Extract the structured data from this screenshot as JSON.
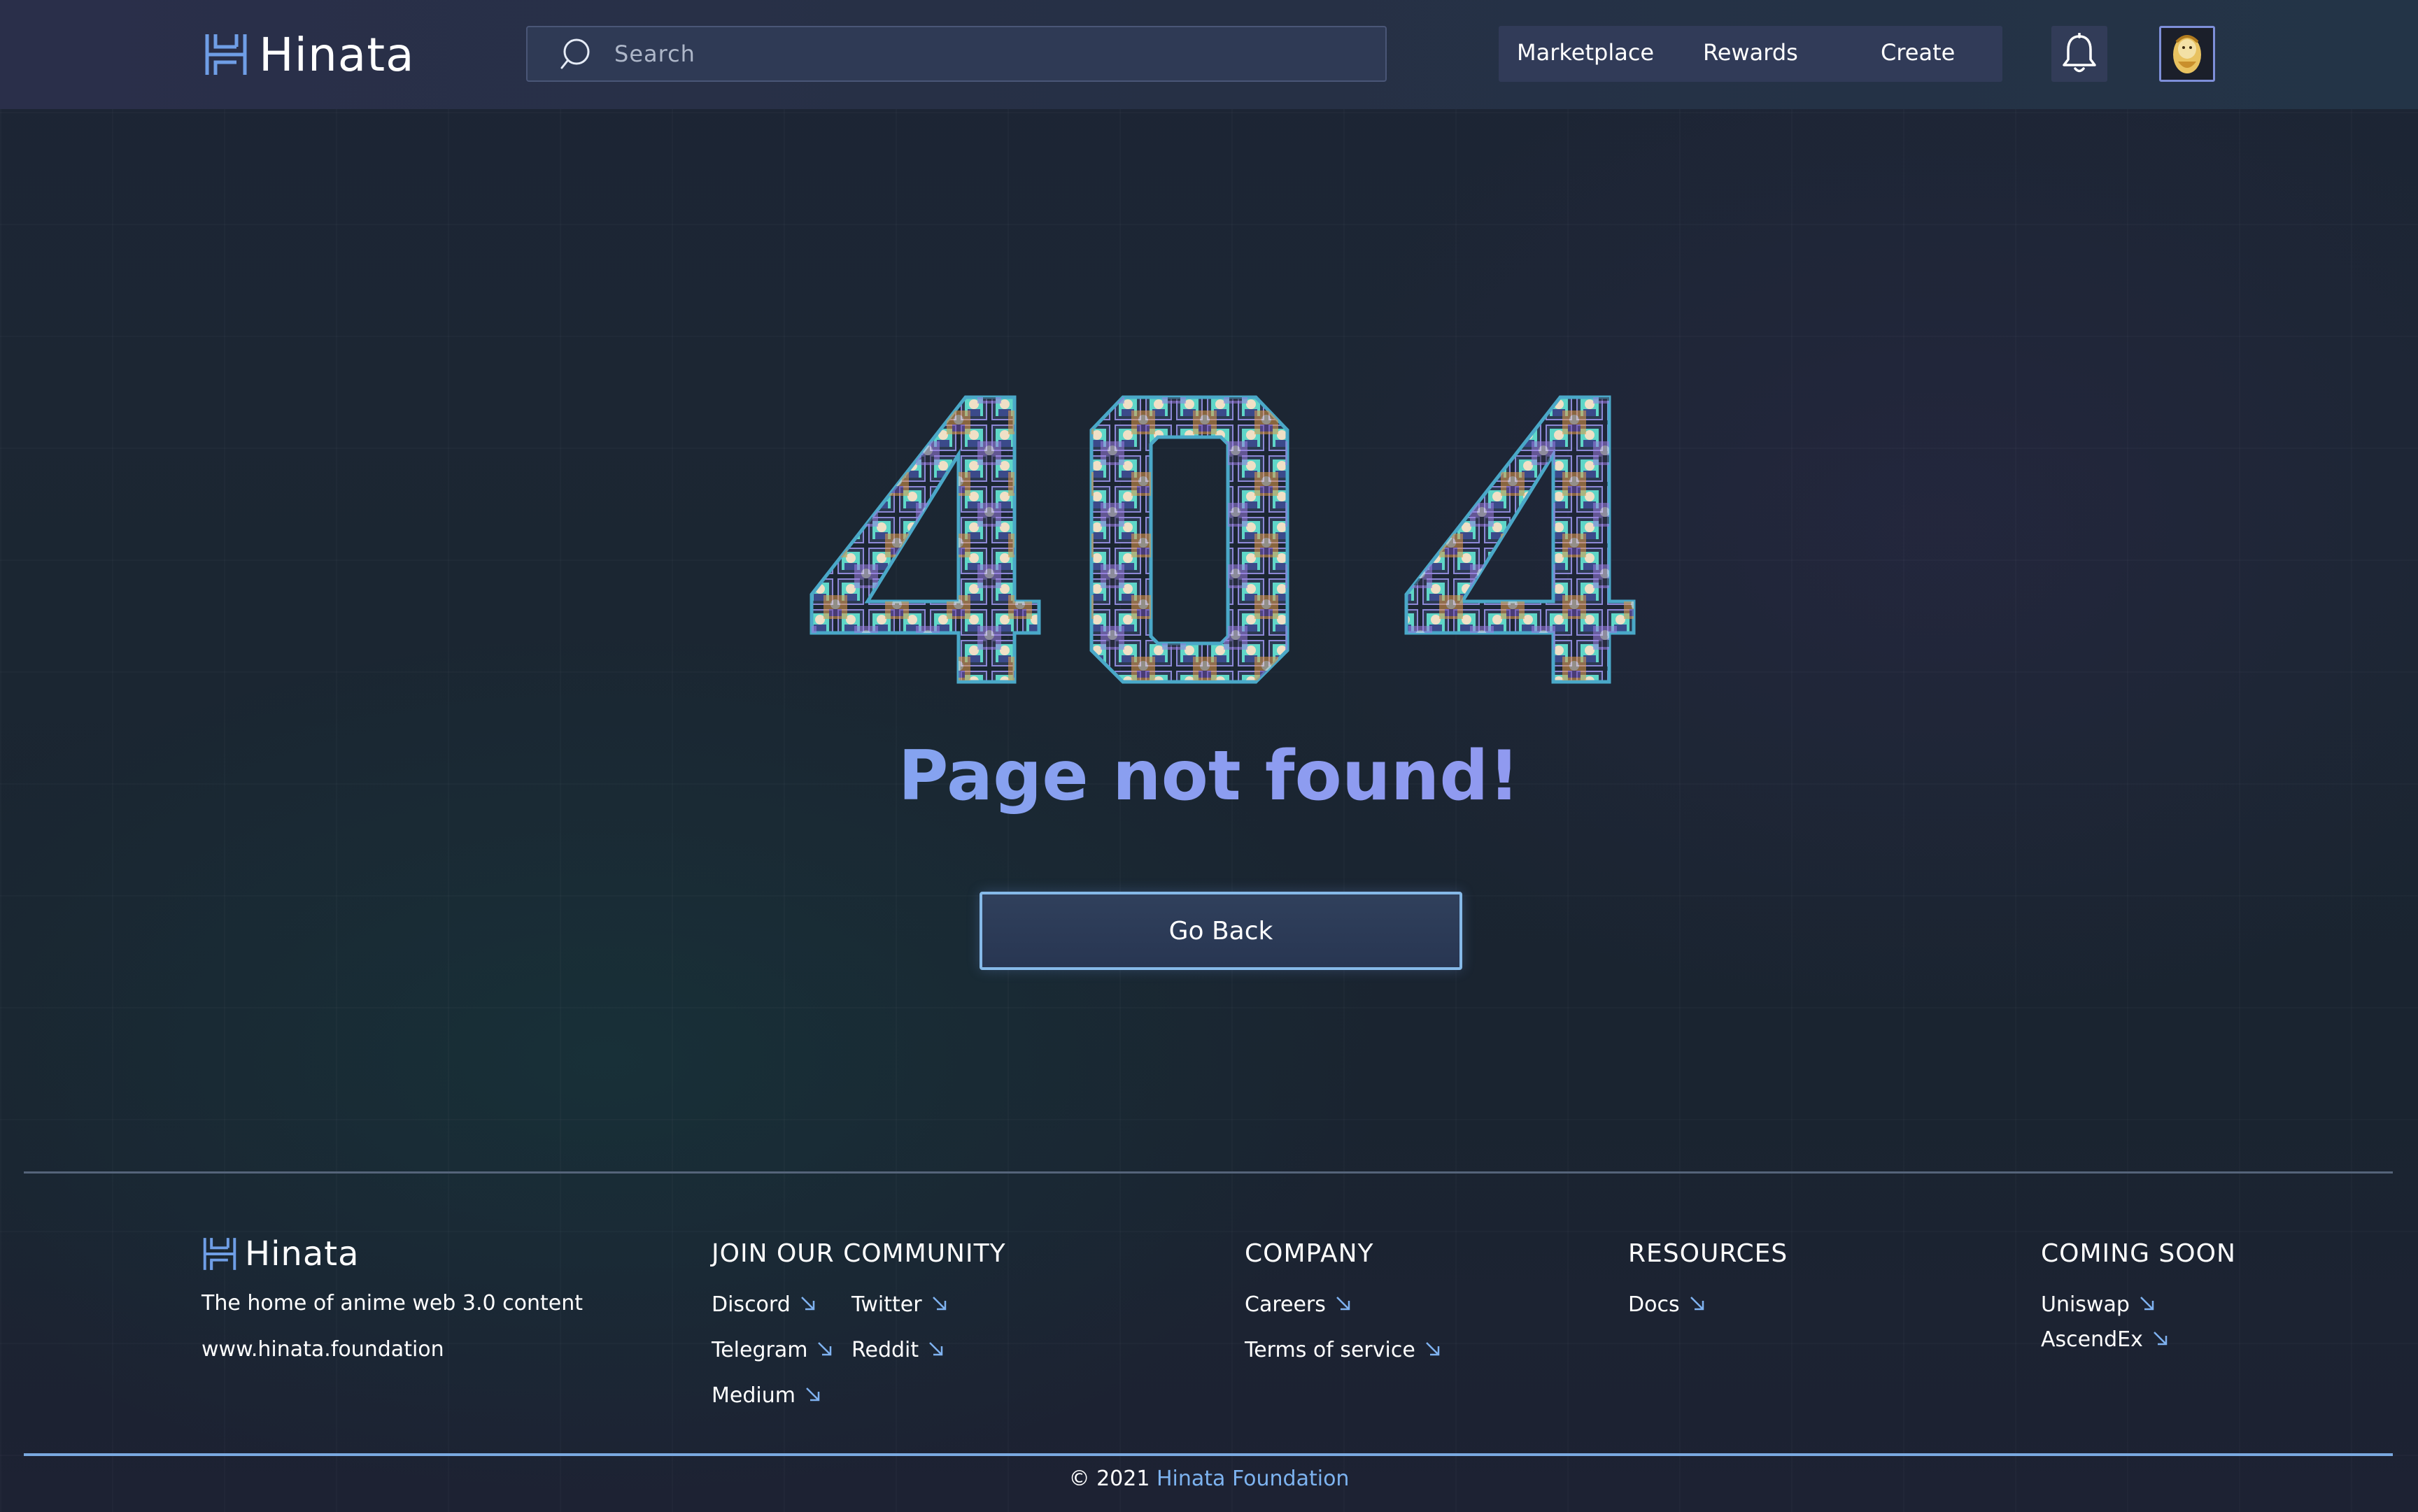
{
  "header": {
    "brand": "Hinata",
    "search_placeholder": "Search",
    "nav": [
      {
        "label": "Marketplace"
      },
      {
        "label": "Rewards"
      },
      {
        "label": "Create"
      }
    ],
    "icons": {
      "logo": "hinata-logo-icon",
      "search": "search-icon",
      "notifications": "bell-icon",
      "avatar": "user-avatar"
    }
  },
  "main": {
    "error_code": "404",
    "title": "Page not found!",
    "back_button": "Go Back",
    "colors": {
      "title_gradient_start": "#6fb6f0",
      "title_gradient_end": "#9c8ff0",
      "button_border": "#86b9e8"
    }
  },
  "footer": {
    "brand": "Hinata",
    "tagline": "The home of anime web 3.0 content",
    "website": "www.hinata.foundation",
    "community": {
      "heading": "JOIN OUR COMMUNITY",
      "links": [
        "Discord",
        "Twitter",
        "Telegram",
        "Reddit",
        "Medium"
      ]
    },
    "company": {
      "heading": "COMPANY",
      "links": [
        "Careers",
        "Terms of service"
      ]
    },
    "resources": {
      "heading": "RESOURCES",
      "links": [
        "Docs"
      ]
    },
    "coming_soon": {
      "heading": "COMING SOON",
      "links": [
        "Uniswap",
        "AscendEx"
      ]
    },
    "copyright_prefix": "© 2021",
    "copyright_brand": "Hinata Foundation",
    "link_icon": "arrow-down-right-icon"
  }
}
